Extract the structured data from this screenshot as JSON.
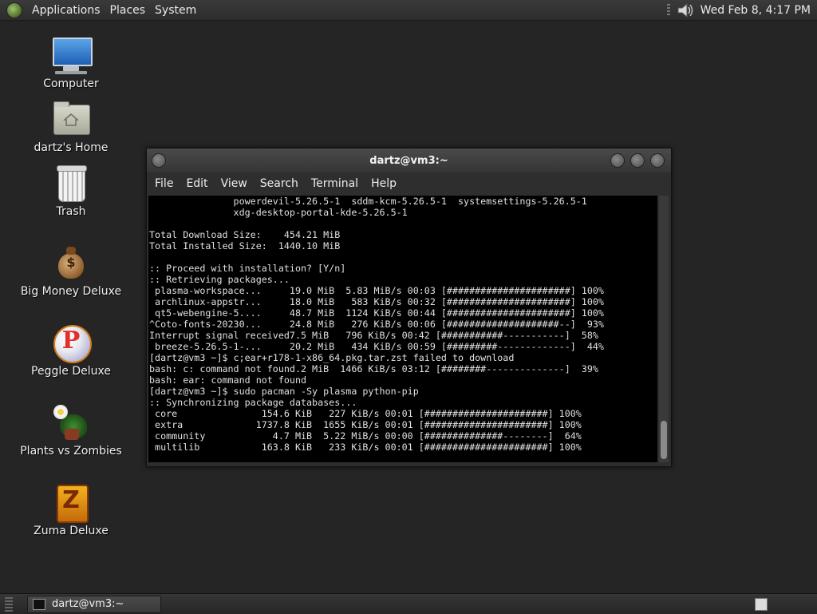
{
  "top_panel": {
    "menus": [
      "Applications",
      "Places",
      "System"
    ],
    "clock": "Wed Feb  8,  4:17 PM",
    "icons": {
      "logo": "gnome-foot-icon",
      "volume": "volume-icon"
    }
  },
  "desktop": {
    "icons": [
      {
        "label": "Computer",
        "icon": "computer-icon"
      },
      {
        "label": "dartz's Home",
        "icon": "home-folder-icon"
      },
      {
        "label": "Trash",
        "icon": "trash-icon"
      },
      {
        "label": "Big Money Deluxe",
        "icon": "money-bag-icon"
      },
      {
        "label": "Peggle Deluxe",
        "icon": "peggle-icon"
      },
      {
        "label": "Plants vs Zombies",
        "icon": "plants-icon"
      },
      {
        "label": "Zuma Deluxe",
        "icon": "zuma-icon"
      }
    ]
  },
  "terminal_window": {
    "title": "dartz@vm3:~",
    "menu": [
      "File",
      "Edit",
      "View",
      "Search",
      "Terminal",
      "Help"
    ],
    "lines": [
      "               powerdevil-5.26.5-1  sddm-kcm-5.26.5-1  systemsettings-5.26.5-1",
      "               xdg-desktop-portal-kde-5.26.5-1",
      "",
      "Total Download Size:    454.21 MiB",
      "Total Installed Size:  1440.10 MiB",
      "",
      ":: Proceed with installation? [Y/n]",
      ":: Retrieving packages...",
      " plasma-workspace...     19.0 MiB  5.83 MiB/s 00:03 [######################] 100%",
      " archlinux-appstr...     18.0 MiB   583 KiB/s 00:32 [######################] 100%",
      " qt5-webengine-5....     48.7 MiB  1124 KiB/s 00:44 [######################] 100%",
      "^Coto-fonts-20230...     24.8 MiB   276 KiB/s 00:06 [####################--]  93%",
      "Interrupt signal received7.5 MiB   796 KiB/s 00:42 [###########-----------]  58%",
      " breeze-5.26.5-1-...     20.2 MiB   434 KiB/s 00:59 [#########-------------]  44%",
      "[dartz@vm3 ~]$ c;ear+r178-1-x86_64.pkg.tar.zst failed to download",
      "bash: c: command not found.2 MiB  1466 KiB/s 03:12 [########--------------]  39%",
      "bash: ear: command not found",
      "[dartz@vm3 ~]$ sudo pacman -Sy plasma python-pip",
      ":: Synchronizing package databases...",
      " core               154.6 KiB   227 KiB/s 00:01 [######################] 100%",
      " extra             1737.8 KiB  1655 KiB/s 00:01 [######################] 100%",
      " community            4.7 MiB  5.22 MiB/s 00:00 [##############--------]  64%",
      " multilib           163.8 KiB   233 KiB/s 00:01 [######################] 100%"
    ]
  },
  "bottom_panel": {
    "task_label": "dartz@vm3:~"
  }
}
